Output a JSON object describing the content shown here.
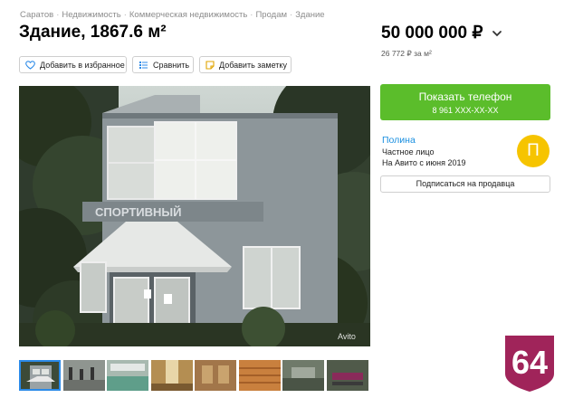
{
  "breadcrumb": [
    "Саратов",
    "Недвижимость",
    "Коммерческая недвижимость",
    "Продам",
    "Здание"
  ],
  "title": "Здание, 1867.6 м²",
  "price": "50 000 000 ₽",
  "price_per_unit": "26 772 ₽ за м²",
  "actions": {
    "favorite": "Добавить в избранное",
    "compare": "Сравнить",
    "note": "Добавить заметку"
  },
  "photo": {
    "sign_text": "СПОРТИВНЫЙ",
    "watermark": "Avito"
  },
  "contact": {
    "call_label": "Показать телефон",
    "phone_masked": "8 961 XXX-XX-XX"
  },
  "seller": {
    "name": "Полина",
    "type": "Частное лицо",
    "since": "На Авито с июня 2019",
    "avatar_letter": "П",
    "subscribe_label": "Подписаться на продавца"
  },
  "region_badge": "64",
  "colors": {
    "accent_green": "#5bbd2b",
    "link_blue": "#1a8fe0",
    "avatar_yellow": "#f6c400",
    "badge": "#a0245a"
  },
  "thumbnails": [
    "thumb-1",
    "thumb-2",
    "thumb-3",
    "thumb-4",
    "thumb-5",
    "thumb-6",
    "thumb-7",
    "thumb-8"
  ]
}
